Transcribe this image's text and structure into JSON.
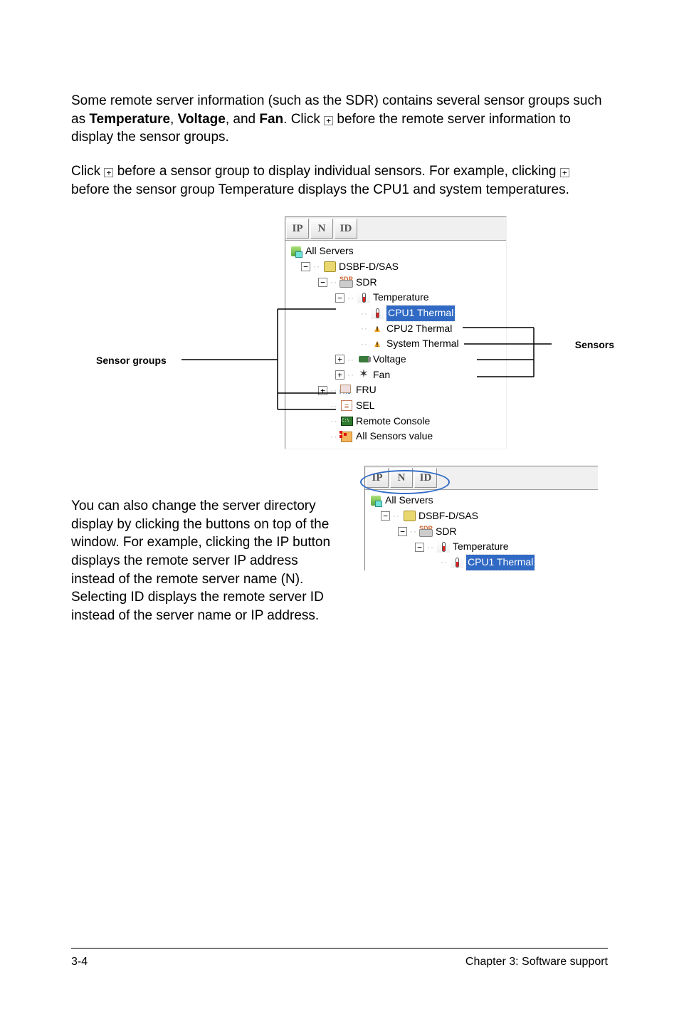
{
  "paragraphs": {
    "p1_a": "Some remote server information (such as the SDR) contains several sensor groups such as ",
    "p1_b": ", ",
    "p1_c": ", and ",
    "p1_d": ". Click ",
    "p1_e": " before the remote server information to display the sensor groups.",
    "p1_strong1": "Temperature",
    "p1_strong2": "Voltage",
    "p1_strong3": "Fan",
    "p2_a": "Click ",
    "p2_b": " before a sensor group to display individual sensors. For example, clicking ",
    "p2_c": " before the sensor group Temperature displays the CPU1 and system temperatures.",
    "p3": "You can also change the server directory display by clicking the buttons on top of the window. For example, clicking the IP button displays the remote server IP address instead of the remote server name (N). Selecting ID displays the remote server ID instead of the server name or IP address."
  },
  "callouts": {
    "sensor_groups": "Sensor groups",
    "sensors": "Sensors"
  },
  "tabs": {
    "ip": "IP",
    "n": "N",
    "id": "ID"
  },
  "tree": {
    "root": "All Servers",
    "host": "DSBF-D/SAS",
    "sdr": "SDR",
    "temp_group": "Temperature",
    "cpu1": "CPU1 Thermal",
    "cpu2": "CPU2 Thermal",
    "system": "System Thermal",
    "voltage": "Voltage",
    "fan": "Fan",
    "fru": "FRU",
    "sel": "SEL",
    "remote_console": "Remote Console",
    "all_sensors": "All Sensors value"
  },
  "snippet": {
    "root": "All Servers",
    "host": "DSBF-D/SAS",
    "sdr": "SDR",
    "temp_group": "Temperature",
    "cpu1": "CPU1 Thermal"
  },
  "footer": {
    "left": "3-4",
    "right": "Chapter 3: Software support"
  },
  "glyphs": {
    "plus": "+",
    "minus": "−"
  }
}
